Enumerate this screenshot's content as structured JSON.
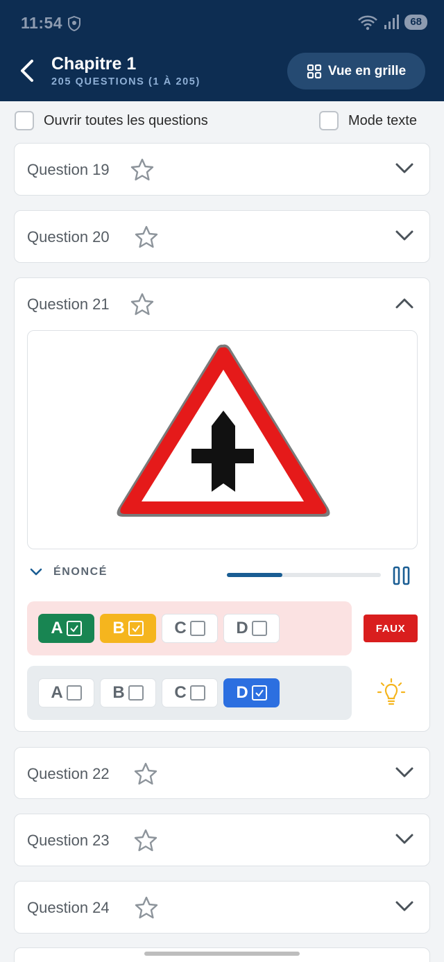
{
  "status_bar": {
    "time": "11:54",
    "battery": "68"
  },
  "header": {
    "title": "Chapitre 1",
    "subtitle": "205 QUESTIONS (1 À 205)",
    "grid_button": "Vue en grille"
  },
  "options": {
    "open_all": "Ouvrir toutes les questions",
    "text_mode": "Mode texte"
  },
  "questions": [
    {
      "label": "Question 19"
    },
    {
      "label": "Question 20"
    },
    {
      "label": "Question 21"
    },
    {
      "label": "Question 22"
    },
    {
      "label": "Question 23"
    },
    {
      "label": "Question 24"
    }
  ],
  "open_question": {
    "enonce_label": "ÉNONCÉ",
    "audio_progress": 0.36,
    "user_answers": [
      "A",
      "B",
      "C",
      "D"
    ],
    "correct_answers": [
      "A",
      "B",
      "C",
      "D"
    ],
    "result": "FAUX"
  },
  "colors": {
    "header": "#0d2d52",
    "selected_green": "#188552",
    "selected_yellow": "#f5b51e",
    "correct_blue": "#2c6fe0",
    "wrong_red": "#d91e1e"
  }
}
